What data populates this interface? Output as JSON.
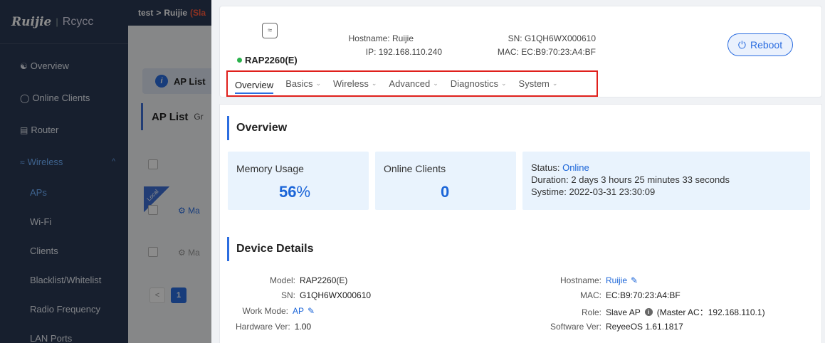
{
  "brand": {
    "logo": "Ruijie",
    "separator": "|",
    "cloud": "Rcycc"
  },
  "topbar": {
    "breadcrumb_root": "test",
    "breadcrumb_sep": ">",
    "breadcrumb_current": "Ruijie",
    "tag": "(Sla"
  },
  "sidebar": {
    "items": [
      {
        "label": "Overview",
        "icon": "topology-icon"
      },
      {
        "label": "Online Clients",
        "icon": "clients-icon"
      },
      {
        "label": "Router",
        "icon": "router-icon"
      },
      {
        "label": "Wireless",
        "icon": "wifi-icon"
      }
    ],
    "wireless_caret": "^",
    "subitems": [
      "APs",
      "Wi-Fi",
      "Clients",
      "Blacklist/Whitelist",
      "Radio Frequency",
      "LAN Ports"
    ]
  },
  "background": {
    "tab_label": "AP List",
    "list_title": "AP List",
    "list_sub": "Gr",
    "local_badge": "Local",
    "row_text_1": "⚙ Ma",
    "row_text_2": "⚙ Ma",
    "pager_prev": "<",
    "pager_current": "1"
  },
  "device_header": {
    "model": "RAP2260(E)",
    "status_color": "#2bb24c",
    "hostname_label": "Hostname:",
    "hostname": "Ruijie",
    "ip_label": "IP:",
    "ip": "192.168.110.240",
    "sn_label": "SN:",
    "sn": "G1QH6WX000610",
    "mac_label": "MAC:",
    "mac": "EC:B9:70:23:A4:BF",
    "reboot_label": "Reboot"
  },
  "tabs": [
    {
      "label": "Overview",
      "has_menu": false
    },
    {
      "label": "Basics",
      "has_menu": true
    },
    {
      "label": "Wireless",
      "has_menu": true
    },
    {
      "label": "Advanced",
      "has_menu": true
    },
    {
      "label": "Diagnostics",
      "has_menu": true
    },
    {
      "label": "System",
      "has_menu": true
    }
  ],
  "overview": {
    "title": "Overview",
    "memory_label": "Memory Usage",
    "memory_value": "56",
    "memory_unit": "%",
    "clients_label": "Online Clients",
    "clients_value": "0",
    "status_label": "Status:",
    "status_value": "Online",
    "duration_label": "Duration:",
    "duration_value": "2 days 3 hours 25 minutes 33 seconds",
    "systime_label": "Systime:",
    "systime_value": "2022-03-31 23:30:09"
  },
  "device_details": {
    "title": "Device Details",
    "model_label": "Model:",
    "model": "RAP2260(E)",
    "sn_label": "SN:",
    "sn": "G1QH6WX000610",
    "work_mode_label": "Work Mode:",
    "work_mode": "AP",
    "hw_label": "Hardware Ver:",
    "hw": "1.00",
    "hostname_label": "Hostname:",
    "hostname": "Ruijie",
    "mac_label": "MAC:",
    "mac": "EC:B9:70:23:A4:BF",
    "role_label": "Role:",
    "role": "Slave AP",
    "master_label": "(Master AC：192.168.110.1)",
    "sw_label": "Software Ver:",
    "sw": "ReyeeOS 1.61.1817"
  },
  "colors": {
    "accent": "#2b6de0",
    "highlight_border": "#e0201c",
    "card_bg": "#e9f3fd"
  }
}
